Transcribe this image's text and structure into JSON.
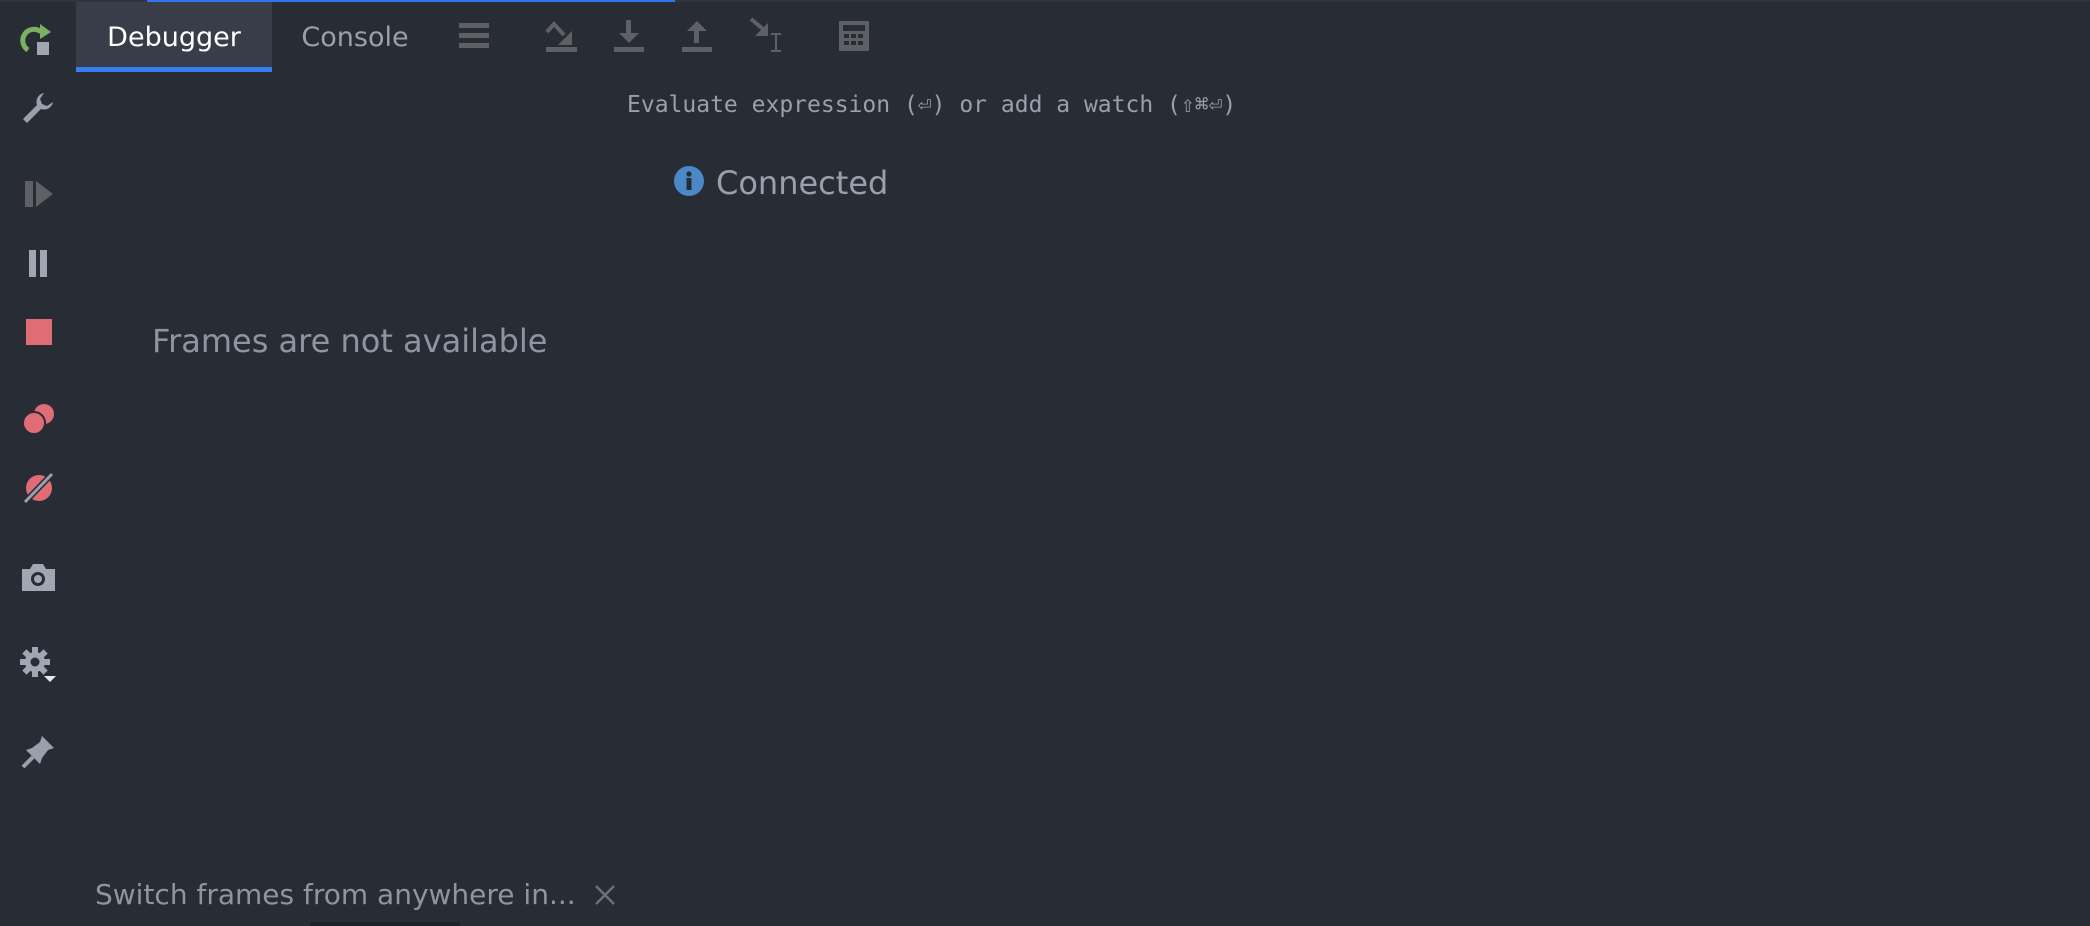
{
  "tabs": [
    {
      "label": "Debugger",
      "active": true
    },
    {
      "label": "Console",
      "active": false
    }
  ],
  "toolbar": {
    "icons": [
      "list-icon",
      "step-over-icon",
      "step-into-icon",
      "step-out-icon",
      "run-to-cursor-icon",
      "evaluate-expression-icon"
    ]
  },
  "sidebar": {
    "icons": [
      "rerun-icon",
      "wrench-icon",
      "resume-icon",
      "pause-icon",
      "stop-icon",
      "view-breakpoints-icon",
      "mute-breakpoints-icon",
      "camera-icon",
      "settings-icon",
      "pin-icon"
    ]
  },
  "watches": {
    "placeholder": "Evaluate expression (⏎) or add a watch (⇧⌘⏎)"
  },
  "status": {
    "text": "Connected",
    "icon": "info-icon"
  },
  "frames": {
    "empty_text": "Frames are not available"
  },
  "hint": {
    "text": "Switch frames from anywhere in..."
  },
  "colors": {
    "accent": "#3a7cf5",
    "background": "#282c35",
    "tab_active_bg": "#393d4a",
    "stop": "#e06c75",
    "rerun": "#7bb062",
    "info": "#4a88c7"
  }
}
